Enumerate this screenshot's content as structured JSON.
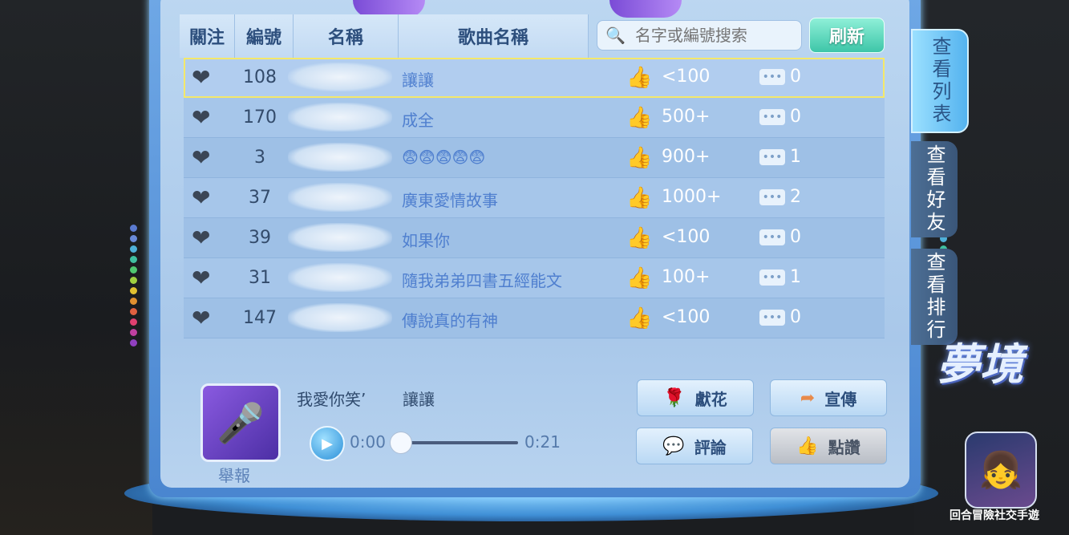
{
  "header": {
    "col_follow": "關注",
    "col_number": "編號",
    "col_name": "名稱",
    "col_song": "歌曲名稱",
    "search_placeholder": "名字或編號搜索",
    "refresh_label": "刷新"
  },
  "rows": [
    {
      "number": "108",
      "song": "讓讓",
      "likes": "<100",
      "comments": "0"
    },
    {
      "number": "170",
      "song": "成全",
      "likes": "500+",
      "comments": "0"
    },
    {
      "number": "3",
      "song": "😨😨😨😨😨",
      "likes": "900+",
      "comments": "1"
    },
    {
      "number": "37",
      "song": "廣東愛情故事",
      "likes": "1000+",
      "comments": "2"
    },
    {
      "number": "39",
      "song": "如果你",
      "likes": "<100",
      "comments": "0"
    },
    {
      "number": "31",
      "song": "隨我弟弟四書五經能文",
      "likes": "100+",
      "comments": "1"
    },
    {
      "number": "147",
      "song": "傳說真的有神",
      "likes": "<100",
      "comments": "0"
    }
  ],
  "player": {
    "report_label": "舉報",
    "singer": "我愛你笑’",
    "song": "讓讓",
    "time_current": "0:00",
    "time_total": "0:21",
    "progress": 0
  },
  "actions": {
    "flower_label": "獻花",
    "promote_label": "宣傳",
    "comment_label": "評論",
    "like_label": "點讚"
  },
  "tabs": {
    "list": "查看列表",
    "friends": "查看好友",
    "ranking": "查看排行"
  },
  "branding": {
    "logo_text": "夢境",
    "tagline": "回合冒險社交手遊"
  },
  "colors": {
    "selected_outline": "#f4e86a",
    "accent_refresh": "#3dc6a8",
    "like_thumb": "#f3b934"
  }
}
